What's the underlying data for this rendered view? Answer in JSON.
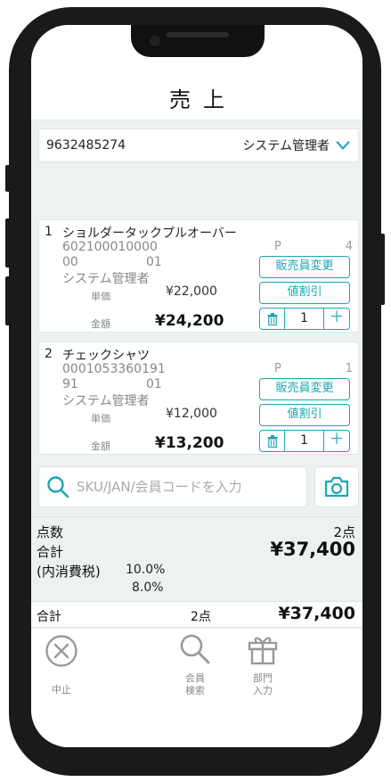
{
  "header": {
    "title": "売上"
  },
  "staff_bar": {
    "code": "9632485274",
    "staff": "システム管理者"
  },
  "items": [
    {
      "index": "1",
      "name": "ショルダータックプルオーバー",
      "sku": "602100010000",
      "color": "00",
      "size": "01",
      "staff": "システム管理者",
      "p_label": "P",
      "p_value": "4",
      "unit_label": "単価",
      "unit_price": "¥22,000",
      "amount_label": "金額",
      "amount": "¥24,200",
      "staff_change_label": "販売員変更",
      "discount_label": "値割引",
      "qty": "1",
      "plus": "＋"
    },
    {
      "index": "2",
      "name": "チェックシャツ",
      "sku": "0001053360191",
      "color": "91",
      "size": "01",
      "staff": "システム管理者",
      "p_label": "P",
      "p_value": "1",
      "unit_label": "単価",
      "unit_price": "¥12,000",
      "amount_label": "金額",
      "amount": "¥13,200",
      "staff_change_label": "販売員変更",
      "discount_label": "値割引",
      "qty": "1",
      "plus": "＋"
    }
  ],
  "search": {
    "placeholder": "SKU/JAN/会員コードを入力"
  },
  "summary": {
    "count_label": "点数",
    "count_value": "2点",
    "total_label": "合計",
    "total_value": "¥37,400",
    "tax_label": "(内消費税)",
    "tax_rate_1": "10.0%",
    "tax_rate_2": "8.0%"
  },
  "total_bar": {
    "label": "合計",
    "count": "2点",
    "amount": "¥37,400"
  },
  "footer": {
    "cancel_label": "中止",
    "member_search_label_1": "会員",
    "member_search_label_2": "検索",
    "dept_label_1": "部門",
    "dept_label_2": "入力"
  },
  "colors": {
    "accent": "#1aa6b7",
    "background": "#edf1f2"
  }
}
